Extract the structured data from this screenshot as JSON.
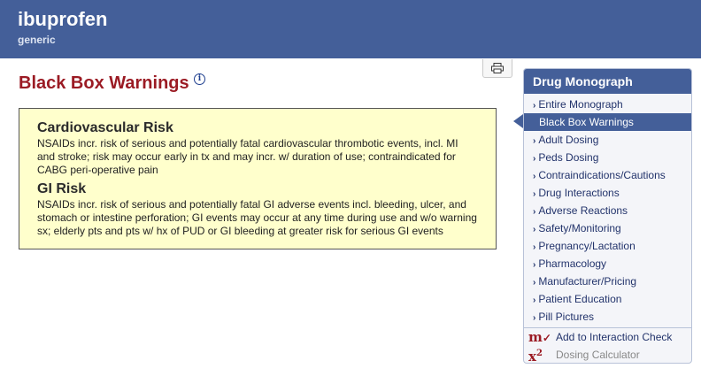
{
  "header": {
    "drug_name": "ibuprofen",
    "drug_type": "generic"
  },
  "main": {
    "title": "Black Box Warnings",
    "info_icon": "info-icon",
    "print_icon": "printer-icon",
    "warnings": [
      {
        "title": "Cardiovascular Risk",
        "text": "NSAIDs incr. risk of serious and potentially fatal cardiovascular thrombotic events, incl. MI and stroke; risk may occur early in tx and may incr. w/ duration of use; contraindicated for CABG peri-operative pain"
      },
      {
        "title": "GI Risk",
        "text": "NSAIDs incr. risk of serious and potentially fatal GI adverse events incl. bleeding, ulcer, and stomach or intestine perforation; GI events may occur at any time during use and w/o warning sx; elderly pts and pts w/ hx of PUD or GI bleeding at greater risk for serious GI events"
      }
    ]
  },
  "sidebar": {
    "title": "Drug Monograph",
    "items": [
      {
        "label": "Entire Monograph",
        "active": false
      },
      {
        "label": "Black Box Warnings",
        "active": true
      },
      {
        "label": "Adult Dosing",
        "active": false
      },
      {
        "label": "Peds Dosing",
        "active": false
      },
      {
        "label": "Contraindications/Cautions",
        "active": false
      },
      {
        "label": "Drug Interactions",
        "active": false
      },
      {
        "label": "Adverse Reactions",
        "active": false
      },
      {
        "label": "Safety/Monitoring",
        "active": false
      },
      {
        "label": "Pregnancy/Lactation",
        "active": false
      },
      {
        "label": "Pharmacology",
        "active": false
      },
      {
        "label": "Manufacturer/Pricing",
        "active": false
      },
      {
        "label": "Patient Education",
        "active": false
      },
      {
        "label": "Pill Pictures",
        "active": false
      }
    ],
    "tools": {
      "interaction_check": {
        "icon_text": "m",
        "icon_mark": "✓",
        "label": "Add to Interaction Check"
      },
      "dosing_calculator": {
        "icon_text": "x",
        "icon_sup": "2",
        "label": "Dosing Calculator"
      }
    }
  },
  "colors": {
    "header_bg": "#445f99",
    "title_red": "#9b1b24",
    "warning_bg": "#ffffcc",
    "link_blue": "#22336b"
  }
}
